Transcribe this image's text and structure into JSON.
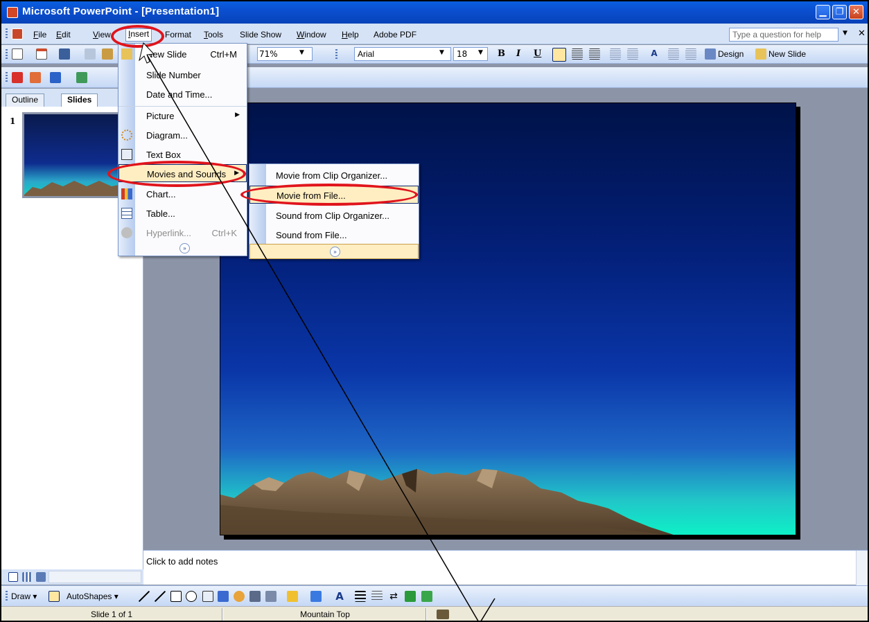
{
  "window": {
    "title": "Microsoft PowerPoint - [Presentation1]"
  },
  "menubar": {
    "items": [
      {
        "label": "File",
        "ul": "F",
        "rest": "ile"
      },
      {
        "label": "Edit",
        "ul": "E",
        "rest": "dit"
      },
      {
        "label": "View",
        "ul": "V",
        "rest": "iew"
      },
      {
        "label": "Insert",
        "ul": "I",
        "rest": "nsert"
      },
      {
        "label": "Format",
        "ul": "",
        "rest": "Format"
      },
      {
        "label": "Tools",
        "ul": "T",
        "rest": "ools"
      },
      {
        "label": "Slide Show",
        "ul": "",
        "rest": "Slide Show"
      },
      {
        "label": "Window",
        "ul": "W",
        "rest": "indow"
      },
      {
        "label": "Help",
        "ul": "H",
        "rest": "elp"
      },
      {
        "label": "Adobe PDF",
        "ul": "",
        "rest": "Adobe PDF"
      }
    ],
    "help_placeholder": "Type a question for help"
  },
  "toolbar": {
    "zoom": "71%",
    "font": "Arial",
    "size": "18",
    "bold": "B",
    "italic": "I",
    "underline": "U",
    "design": "Design",
    "new_slide": "New Slide"
  },
  "tabs": {
    "outline": "Outline",
    "slides": "Slides"
  },
  "slide_number": "1",
  "insert_menu": {
    "items": [
      {
        "label": "New Slide",
        "shortcut": "Ctrl+M"
      },
      {
        "label": "Slide Number",
        "shortcut": ""
      },
      {
        "label": "Date and Time...",
        "shortcut": ""
      },
      {
        "label": "Picture",
        "shortcut": "",
        "submenu": true
      },
      {
        "label": "Diagram...",
        "shortcut": ""
      },
      {
        "label": "Text Box",
        "shortcut": ""
      },
      {
        "label": "Movies and Sounds",
        "shortcut": "",
        "submenu": true,
        "highlighted": true
      },
      {
        "label": "Chart...",
        "shortcut": ""
      },
      {
        "label": "Table...",
        "shortcut": ""
      },
      {
        "label": "Hyperlink...",
        "shortcut": "Ctrl+K",
        "disabled": true
      }
    ]
  },
  "movies_submenu": {
    "items": [
      {
        "label": "Movie from Clip Organizer..."
      },
      {
        "label": "Movie from File...",
        "highlighted": true
      },
      {
        "label": "Sound from Clip Organizer..."
      },
      {
        "label": "Sound from File..."
      }
    ]
  },
  "notes": {
    "placeholder": "Click to add notes"
  },
  "drawbar": {
    "draw": "Draw",
    "autoshapes": "AutoShapes"
  },
  "status": {
    "slide": "Slide 1 of 1",
    "design": "Mountain Top"
  },
  "colors": {
    "title_bar": "#0b4fd0",
    "menu_highlight": "#ffeec2",
    "annotation_ring": "#e0141c"
  }
}
